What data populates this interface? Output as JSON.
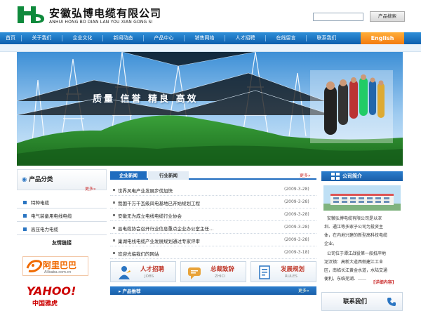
{
  "header": {
    "company_cn": "安徽弘博电缆有限公司",
    "company_en": "ANHUI HONG BO DIAN LAN YOU XIAN GONG SI",
    "search_button": "产品搜索"
  },
  "nav": {
    "items": [
      "首页",
      "关于我们",
      "企业文化",
      "新闻动态",
      "产品中心",
      "销售网络",
      "人才招聘",
      "在线留言",
      "联系我们"
    ],
    "english": "English"
  },
  "banner": {
    "slogan": "质量 信誉 精良 高效"
  },
  "categories": {
    "title": "产品分类",
    "more": "更多»",
    "items": [
      "特种电缆",
      "电气装备用电线电缆",
      "高压电力电缆"
    ]
  },
  "links": {
    "title": "友情链接",
    "alibaba_cn": "阿里巴巴",
    "alibaba_en": "Alibaba.com.cn",
    "yahoo_en": "YAHOO!",
    "yahoo_cn": "中国雅虎"
  },
  "news": {
    "tab_company": "企业新闻",
    "tab_industry": "行业新闻",
    "more": "更多»",
    "items": [
      {
        "title": "世界风电产业发展步伐加快",
        "date": "(2009-3-28)"
      },
      {
        "title": "我国千万千瓦级风电基地已开始规划工程",
        "date": "(2009-3-28)"
      },
      {
        "title": "安徽无为成立电线电缆行业协会",
        "date": "(2009-3-28)"
      },
      {
        "title": "县电缆协会召开行业信息重点企业办公室主任…",
        "date": "(2009-3-28)"
      },
      {
        "title": "巢湖电线电缆产业发展规划通过专家评审",
        "date": "(2009-3-28)"
      },
      {
        "title": "欢迎光临我们的网站",
        "date": "(2009-3-18)"
      }
    ]
  },
  "services": [
    {
      "cn": "人才招聘",
      "en": "JOBS"
    },
    {
      "cn": "总裁致辞",
      "en": "ZHICI"
    },
    {
      "cn": "发展规划",
      "en": "RULES"
    }
  ],
  "products": {
    "title": "产品推荐",
    "more": "更多»"
  },
  "intro": {
    "title": "公司简介",
    "lines": [
      "安徽弘博电缆有限公司是以深",
      "圳、通江等多家子公司为投资主",
      "体，在内地兴建的新型高科技电缆",
      "企业。",
      "公司位于谭江战役第一船抵岸地",
      "泥汊镇：高新大道西侧建江工业",
      "区，南临长江黄金水道，水陆交通",
      "便利。东临芜湖、……"
    ],
    "more": "[详细内容]"
  },
  "contact": {
    "title": "联系我们"
  },
  "colors": {
    "nav_blue": "#1f6cbf",
    "accent_orange": "#f37b10",
    "logo_green": "#0f8a3c"
  }
}
